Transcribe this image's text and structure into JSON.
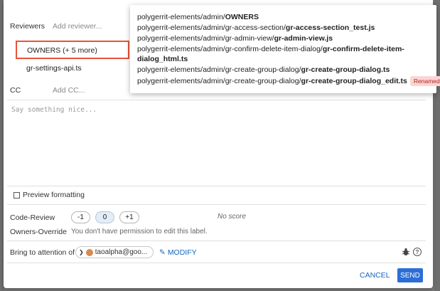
{
  "reviewers": {
    "label": "Reviewers",
    "placeholder": "Add reviewer...",
    "owners_item": "OWNERS (+ 5 more)",
    "file_item": "gr-settings-api.ts"
  },
  "cc": {
    "label": "CC",
    "placeholder": "Add CC..."
  },
  "message": {
    "placeholder": "Say something nice..."
  },
  "preview": {
    "label": "Preview formatting"
  },
  "labels": {
    "code_review": {
      "name": "Code-Review",
      "votes": [
        "-1",
        "0",
        "+1"
      ],
      "selected": "0",
      "status": "No score"
    },
    "owners_override": {
      "name": "Owners-Override",
      "message": "You don't have permission to edit this label."
    }
  },
  "attention": {
    "label": "Bring to attention of",
    "user": "taoalpha@goo...",
    "modify": "MODIFY"
  },
  "actions": {
    "cancel": "CANCEL",
    "send": "SEND"
  },
  "popup": {
    "files": [
      {
        "prefix": "polygerrit-elements/admin/",
        "name": "OWNERS"
      },
      {
        "prefix": "polygerrit-elements/admin/gr-access-section/",
        "name": "gr-access-section_test.js"
      },
      {
        "prefix": "polygerrit-elements/admin/gr-admin-view/",
        "name": "gr-admin-view.js"
      },
      {
        "prefix": "polygerrit-elements/admin/gr-confirm-delete-item-dialog/",
        "name": "gr-confirm-delete-item-"
      },
      {
        "prefix": "",
        "name": "dialog_html.ts"
      },
      {
        "prefix": "polygerrit-elements/admin/gr-create-group-dialog/",
        "name": "gr-create-group-dialog.ts"
      },
      {
        "prefix": "polygerrit-elements/admin/gr-create-group-dialog/",
        "name": "gr-create-group-dialog_edit.ts",
        "badge": "Renamed"
      }
    ]
  },
  "colors": {
    "accent": "#2c6ed6",
    "highlight_border": "#e8543a",
    "badge_bg": "#fbd5d5",
    "badge_text": "#b3261e"
  }
}
